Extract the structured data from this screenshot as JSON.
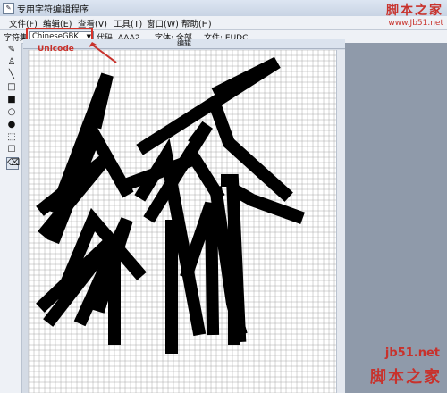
{
  "window": {
    "title": "专用字符编辑程序"
  },
  "menu": [
    {
      "label": "文件(F)"
    },
    {
      "label": "编辑(E)"
    },
    {
      "label": "查看(V)"
    },
    {
      "label": "工具(T)"
    },
    {
      "label": "窗口(W)"
    },
    {
      "label": "帮助(H)"
    }
  ],
  "toolbar": {
    "charset_label": "字符集:",
    "charset_value": "ChineseGBK",
    "code_label": "代码: AAA2",
    "font_label": "字体: 全部",
    "file_label": "文件: EUDC"
  },
  "canvas": {
    "title": "编辑",
    "annotation": "Unicode"
  },
  "tools": [
    {
      "icon": "pencil-icon"
    },
    {
      "icon": "brush-icon"
    },
    {
      "icon": "line-icon"
    },
    {
      "icon": "hollow-rect-icon"
    },
    {
      "icon": "filled-rect-icon"
    },
    {
      "icon": "hollow-ellipse-icon"
    },
    {
      "icon": "filled-ellipse-icon"
    },
    {
      "icon": "rect-select-icon"
    },
    {
      "icon": "freeform-select-icon"
    },
    {
      "icon": "eraser-icon"
    }
  ],
  "watermark": {
    "top_cn": "脚本之家",
    "top_url": "www.Jb51.net",
    "bottom_url": "jb51.net",
    "bottom_cn": "脚本之家"
  },
  "colors": {
    "accent": "#c8322c",
    "glyph": "#000000",
    "grid": "#a8a8a8"
  }
}
